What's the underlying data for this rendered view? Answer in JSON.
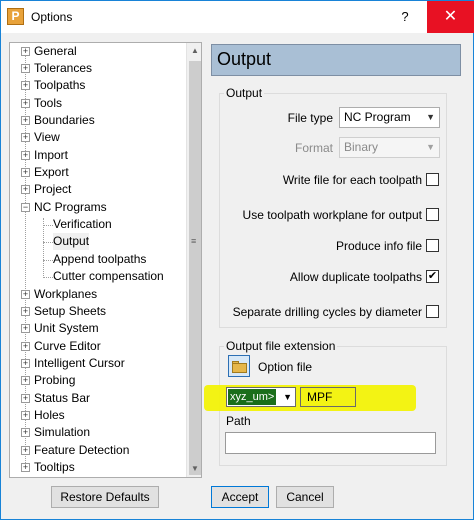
{
  "window": {
    "title": "Options",
    "app_icon_letter": "P",
    "help_label": "?",
    "close_label": "✕"
  },
  "tree": {
    "items": [
      {
        "label": "General",
        "expander": "+"
      },
      {
        "label": "Tolerances",
        "expander": "+"
      },
      {
        "label": "Toolpaths",
        "expander": "+"
      },
      {
        "label": "Tools",
        "expander": "+"
      },
      {
        "label": "Boundaries",
        "expander": "+"
      },
      {
        "label": "View",
        "expander": "+"
      },
      {
        "label": "Import",
        "expander": "+"
      },
      {
        "label": "Export",
        "expander": "+"
      },
      {
        "label": "Project",
        "expander": "+"
      },
      {
        "label": "NC Programs",
        "expander": "−"
      },
      {
        "label": "Verification",
        "expander": ""
      },
      {
        "label": "Output",
        "expander": ""
      },
      {
        "label": "Append toolpaths",
        "expander": ""
      },
      {
        "label": "Cutter compensation",
        "expander": ""
      },
      {
        "label": "Workplanes",
        "expander": "+"
      },
      {
        "label": "Setup Sheets",
        "expander": "+"
      },
      {
        "label": "Unit System",
        "expander": "+"
      },
      {
        "label": "Curve Editor",
        "expander": "+"
      },
      {
        "label": "Intelligent Cursor",
        "expander": "+"
      },
      {
        "label": "Probing",
        "expander": "+"
      },
      {
        "label": "Status Bar",
        "expander": "+"
      },
      {
        "label": "Holes",
        "expander": "+"
      },
      {
        "label": "Simulation",
        "expander": "+"
      },
      {
        "label": "Feature Detection",
        "expander": "+"
      },
      {
        "label": "Tooltips",
        "expander": "+"
      }
    ],
    "selected": "Output",
    "scroll_up": "▲",
    "scroll_down": "▼",
    "grip": "≡"
  },
  "panel": {
    "heading": "Output",
    "output_group": {
      "title": "Output",
      "file_type_label": "File type",
      "file_type_value": "NC Program",
      "format_label": "Format",
      "format_value": "Binary",
      "checkboxes": [
        {
          "label": "Write file for each toolpath",
          "checked": false
        },
        {
          "label": "Use toolpath workplane for output",
          "checked": false
        },
        {
          "label": "Produce info file",
          "checked": false
        },
        {
          "label": "Allow duplicate toolpaths",
          "checked": true
        },
        {
          "label": "Separate drilling cycles by diameter",
          "checked": false
        }
      ]
    },
    "extension_group": {
      "title": "Output file extension",
      "option_file_label": "Option file",
      "option_select_value": "xyz_um>",
      "extension_value": "MPF",
      "path_label": "Path",
      "path_value": ""
    }
  },
  "buttons": {
    "restore": "Restore Defaults",
    "accept": "Accept",
    "cancel": "Cancel"
  },
  "colors": {
    "close_red": "#e81123",
    "header_blue": "#a9bfd5",
    "highlight_yellow": "#f2f207",
    "selection_green": "#1a6e1a"
  }
}
